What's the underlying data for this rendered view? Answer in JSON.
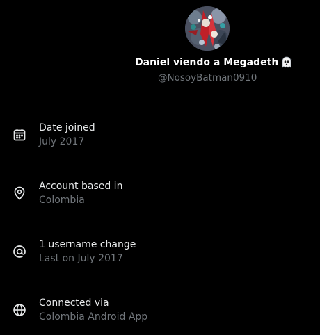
{
  "profile": {
    "display_name": "Daniel viendo a Megadeth",
    "display_name_emoji_icon": "ghost-icon",
    "handle": "@NosoyBatman0910"
  },
  "info_items": [
    {
      "icon": "calendar-icon",
      "title": "Date joined",
      "value": "July 2017"
    },
    {
      "icon": "location-pin-icon",
      "title": "Account based in",
      "value": "Colombia"
    },
    {
      "icon": "at-sign-icon",
      "title": "1 username change",
      "value": "Last on July 2017"
    },
    {
      "icon": "globe-icon",
      "title": "Connected via",
      "value": "Colombia Android App"
    }
  ],
  "colors": {
    "background": "#000000",
    "primary_text": "#e7e9ea",
    "secondary_text": "#71767b"
  }
}
